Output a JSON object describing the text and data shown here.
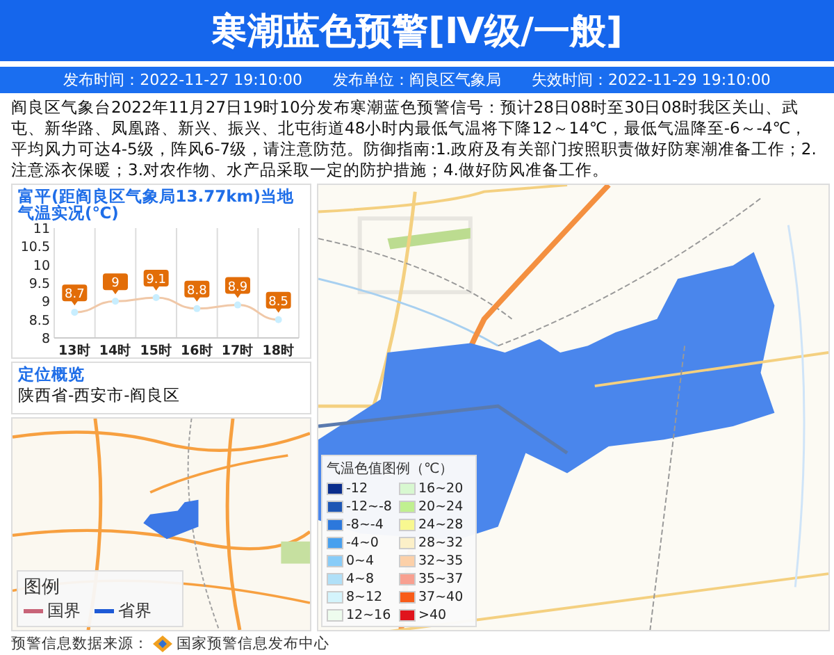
{
  "header": {
    "title": "寒潮蓝色预警[Ⅳ级/一般]"
  },
  "info_bar": [
    {
      "label": "发布时间：",
      "value": "2022-11-27 19:10:00"
    },
    {
      "label": "发布单位：",
      "value": "阎良区气象局"
    },
    {
      "label": "失效时间：",
      "value": "2022-11-29 19:10:00"
    }
  ],
  "description": "阎良区气象台2022年11月27日19时10分发布寒潮蓝色预警信号：预计28日08时至30日08时我区关山、武屯、新华路、凤凰路、新兴、振兴、北屯街道48小时内最低气温将下降12～14℃，最低气温降至-6～-4℃，平均风力可达4-5级，阵风6-7级，请注意防范。防御指南:1.政府及有关部门按照职责做好防寒潮准备工作；2.注意添衣保暖；3.对农作物、水产品采取一定的防护措施；4.做好防风准备工作。",
  "temperature_panel": {
    "title": "富平(距阎良区气象局13.77km)当地气温实况(℃)",
    "chart_data": {
      "type": "line",
      "categories": [
        "13时",
        "14时",
        "15时",
        "16时",
        "17时",
        "18时"
      ],
      "series": [
        {
          "color": "#f0c8a8",
          "marker": true,
          "values": [
            8.7,
            9,
            9.1,
            8.8,
            8.9,
            8.5
          ]
        }
      ],
      "ylim": [
        8,
        11
      ],
      "yticks": [
        8,
        8.5,
        9,
        9.5,
        10,
        10.5,
        11
      ],
      "data_labels": true
    }
  },
  "location_panel": {
    "title": "定位概览",
    "location": "陕西省-西安市-阎良区",
    "map": {
      "kind": "picture",
      "legend": {
        "title": "图例",
        "items": [
          {
            "label": "国界",
            "color": "#c86478"
          },
          {
            "label": "省界",
            "color": "#1e5ad6"
          }
        ]
      }
    }
  },
  "detail_map": {
    "kind": "picture",
    "legend": {
      "title": "气温色值图例（℃）",
      "items": [
        {
          "label": "-12",
          "color": "#0a2d8c"
        },
        {
          "label": "16~20",
          "color": "#d8f8d0"
        },
        {
          "label": "-12~-8",
          "color": "#1e56b4"
        },
        {
          "label": "20~24",
          "color": "#c0f090"
        },
        {
          "label": "-8~-4",
          "color": "#2c78dc"
        },
        {
          "label": "24~28",
          "color": "#f8f890"
        },
        {
          "label": "-4~0",
          "color": "#48a0ee"
        },
        {
          "label": "28~32",
          "color": "#fcf0c8"
        },
        {
          "label": "0~4",
          "color": "#88ccf8"
        },
        {
          "label": "32~35",
          "color": "#fcd0a8"
        },
        {
          "label": "4~8",
          "color": "#b0e0f8"
        },
        {
          "label": "35~37",
          "color": "#f8a090"
        },
        {
          "label": "8~12",
          "color": "#d4f4fc"
        },
        {
          "label": "37~40",
          "color": "#f85c18"
        },
        {
          "label": "12~16",
          "color": "#eefcee"
        },
        {
          "label": ">40",
          "color": "#e0141c"
        }
      ]
    }
  },
  "footer": {
    "label": "预警信息数据来源：",
    "source": "国家预警信息发布中心"
  }
}
